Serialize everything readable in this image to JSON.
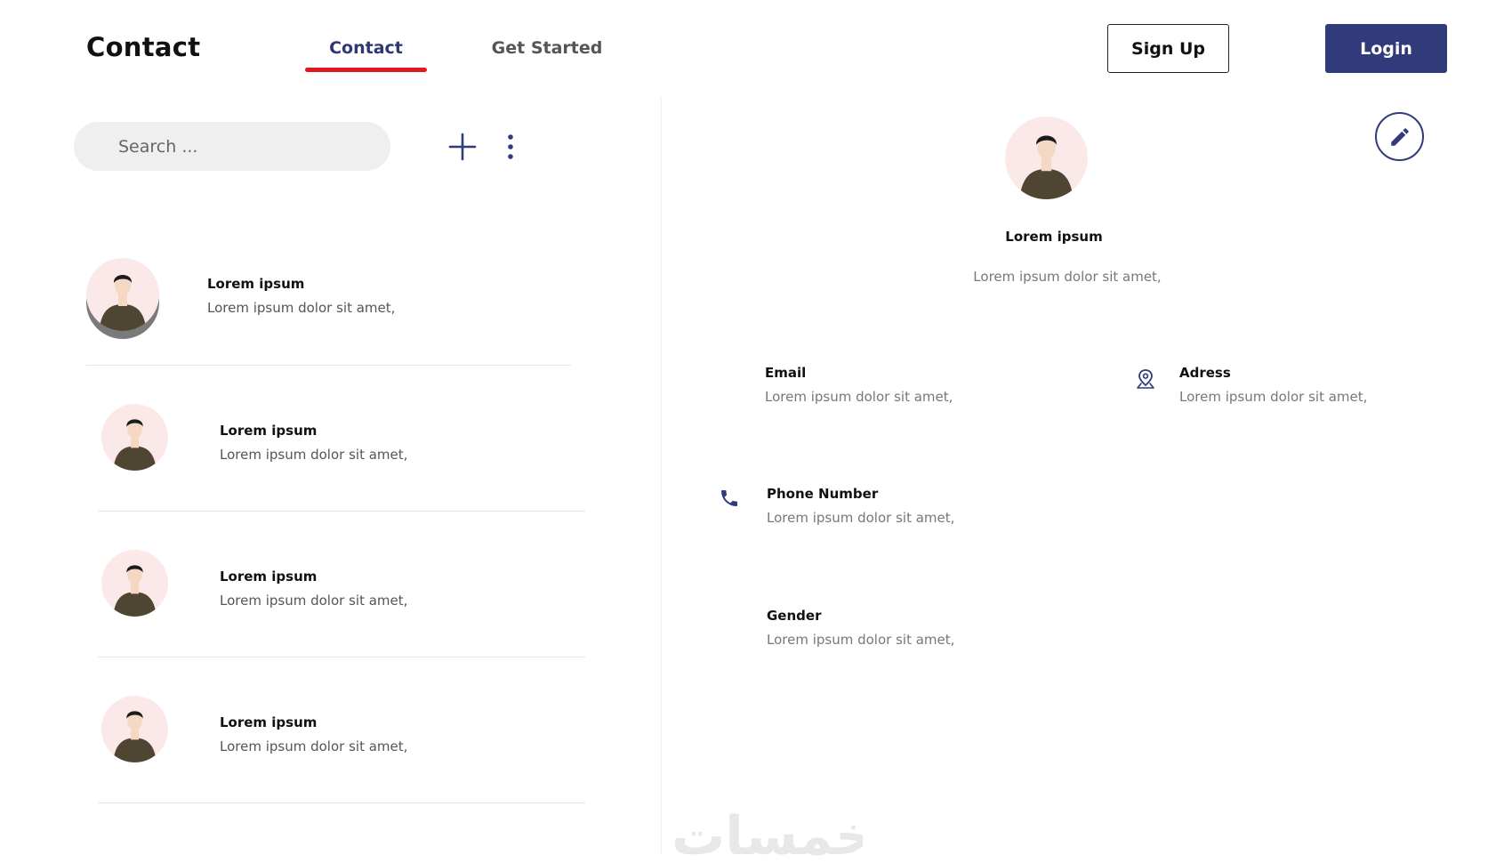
{
  "header": {
    "brand": "Contact",
    "tabs": [
      {
        "label": "Contact",
        "active": true
      },
      {
        "label": "Get Started",
        "active": false
      }
    ],
    "signup_label": "Sign Up",
    "login_label": "Login"
  },
  "toolbar": {
    "search_placeholder": "Search ..."
  },
  "contacts": [
    {
      "name": "Lorem ipsum",
      "subtitle": "Lorem ipsum dolor sit amet,"
    },
    {
      "name": "Lorem ipsum",
      "subtitle": "Lorem ipsum dolor sit amet,"
    },
    {
      "name": "Lorem ipsum",
      "subtitle": "Lorem ipsum dolor sit amet,"
    },
    {
      "name": "Lorem ipsum",
      "subtitle": "Lorem ipsum dolor sit amet,"
    }
  ],
  "detail": {
    "name": "Lorem ipsum",
    "subtitle": "Lorem ipsum dolor sit amet,",
    "fields": {
      "email": {
        "label": "Email",
        "value": "Lorem ipsum dolor sit amet,",
        "icon": "mail-icon"
      },
      "address": {
        "label": "Adress",
        "value": "Lorem ipsum dolor sit amet,",
        "icon": "location-pin-icon"
      },
      "phone": {
        "label": "Phone Number",
        "value": "Lorem ipsum dolor sit amet,",
        "icon": "phone-icon"
      },
      "gender": {
        "label": "Gender",
        "value": "Lorem ipsum dolor sit amet,",
        "icon": "gender-icon"
      }
    }
  },
  "watermark": "خمسات",
  "colors": {
    "primary": "#313a7a",
    "active_underline": "#e0191f",
    "avatar_bg": "#fbe8e8",
    "search_bg": "#efefef"
  }
}
